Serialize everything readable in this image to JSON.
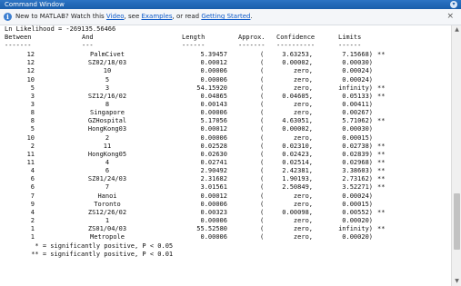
{
  "window": {
    "title": "Command Window",
    "control_icon": "chevron-down-icon"
  },
  "banner": {
    "prefix": "New to MATLAB? Watch this ",
    "video_link": "Video",
    "sep1": ", see ",
    "examples_link": "Examples",
    "sep2": ", or read ",
    "getting_started_link": "Getting Started",
    "suffix": ".",
    "close": "×"
  },
  "output": {
    "likelihood": "Ln Likelihood = -269135.56466",
    "headers": {
      "between": "Between",
      "and": "And",
      "length": "Length",
      "approx": "Approx.",
      "confidence": "Confidence",
      "limits": "Limits"
    },
    "rules": {
      "between": "-------",
      "and": "---",
      "length": "------",
      "approx": "-------",
      "confidence": "----------",
      "limits": "------"
    },
    "rows": [
      {
        "between": "12",
        "and": "PalmCivet",
        "length": "5.39457",
        "open": "(",
        "low": "3.63253,",
        "high": "7.15668)",
        "sig": "**"
      },
      {
        "between": "12",
        "and": "SZ02/18/03",
        "length": "0.00012",
        "open": "(",
        "low": "0.00002,",
        "high": "0.00030)",
        "sig": ""
      },
      {
        "between": "12",
        "and": "10",
        "length": "0.00006",
        "open": "(",
        "low": "zero,",
        "high": "0.00024)",
        "sig": ""
      },
      {
        "between": "10",
        "and": "5",
        "length": "0.00006",
        "open": "(",
        "low": "zero,",
        "high": "0.00024)",
        "sig": ""
      },
      {
        "between": "5",
        "and": "3",
        "length": "54.15920",
        "open": "(",
        "low": "zero,",
        "high": "infinity)",
        "sig": "**"
      },
      {
        "between": "3",
        "and": "SZ12/16/02",
        "length": "0.04865",
        "open": "(",
        "low": "0.04605,",
        "high": "0.05133)",
        "sig": "**"
      },
      {
        "between": "3",
        "and": "8",
        "length": "0.00143",
        "open": "(",
        "low": "zero,",
        "high": "0.00411)",
        "sig": ""
      },
      {
        "between": "8",
        "and": "Singapore",
        "length": "0.00006",
        "open": "(",
        "low": "zero,",
        "high": "0.00267)",
        "sig": ""
      },
      {
        "between": "8",
        "and": "GZHospital",
        "length": "5.17056",
        "open": "(",
        "low": "4.63051,",
        "high": "5.71062)",
        "sig": "**"
      },
      {
        "between": "5",
        "and": "HongKong03",
        "length": "0.00012",
        "open": "(",
        "low": "0.00002,",
        "high": "0.00030)",
        "sig": ""
      },
      {
        "between": "10",
        "and": "2",
        "length": "0.00006",
        "open": "(",
        "low": "zero,",
        "high": "0.00015)",
        "sig": ""
      },
      {
        "between": "2",
        "and": "11",
        "length": "0.02528",
        "open": "(",
        "low": "0.02310,",
        "high": "0.02738)",
        "sig": "**"
      },
      {
        "between": "11",
        "and": "HongKong05",
        "length": "0.02630",
        "open": "(",
        "low": "0.02423,",
        "high": "0.02839)",
        "sig": "**"
      },
      {
        "between": "11",
        "and": "4",
        "length": "0.02741",
        "open": "(",
        "low": "0.02514,",
        "high": "0.02968)",
        "sig": "**"
      },
      {
        "between": "4",
        "and": "6",
        "length": "2.90492",
        "open": "(",
        "low": "2.42381,",
        "high": "3.38603)",
        "sig": "**"
      },
      {
        "between": "6",
        "and": "SZ01/24/03",
        "length": "2.31682",
        "open": "(",
        "low": "1.90193,",
        "high": "2.73162)",
        "sig": "**"
      },
      {
        "between": "6",
        "and": "7",
        "length": "3.01561",
        "open": "(",
        "low": "2.50849,",
        "high": "3.52271)",
        "sig": "**"
      },
      {
        "between": "7",
        "and": "Hanoi",
        "length": "0.00012",
        "open": "(",
        "low": "zero,",
        "high": "0.00024)",
        "sig": ""
      },
      {
        "between": "9",
        "and": "Toronto",
        "length": "0.00006",
        "open": "(",
        "low": "zero,",
        "high": "0.00015)",
        "sig": ""
      },
      {
        "between": "4",
        "and": "ZS12/26/02",
        "length": "0.00323",
        "open": "(",
        "low": "0.00098,",
        "high": "0.00552)",
        "sig": "**"
      },
      {
        "between": "2",
        "and": "1",
        "length": "0.00006",
        "open": "(",
        "low": "zero,",
        "high": "0.00020)",
        "sig": ""
      },
      {
        "between": "1",
        "and": "ZS01/04/03",
        "length": "55.52580",
        "open": "(",
        "low": "zero,",
        "high": "infinity)",
        "sig": "**"
      },
      {
        "between": "1",
        "and": "Metropole",
        "length": "0.00006",
        "open": "(",
        "low": "zero,",
        "high": "0.00020)",
        "sig": ""
      }
    ],
    "footnotes": [
      "  * = significantly positive, P < 0.05",
      " ** = significantly positive, P < 0.01"
    ]
  },
  "scrollbar": {
    "up_icon": "▲",
    "down_icon": "▼"
  }
}
